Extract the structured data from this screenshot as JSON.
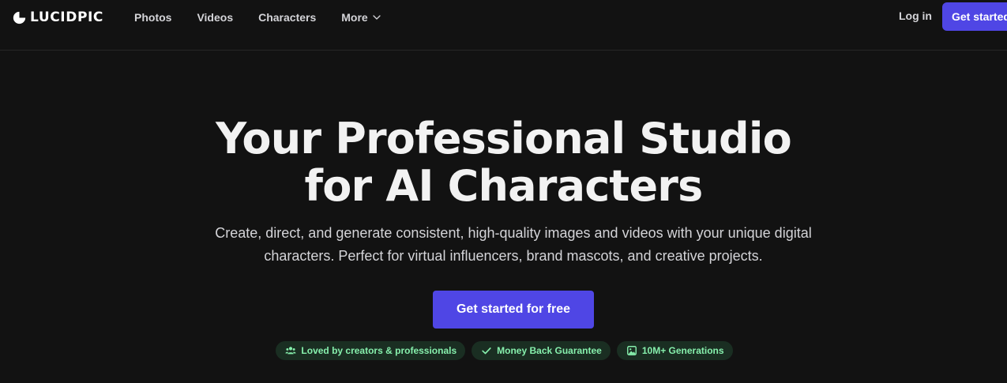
{
  "brand": {
    "name": "LUCIDPIC"
  },
  "nav": {
    "links": [
      "Photos",
      "Videos",
      "Characters",
      "More"
    ],
    "login_label": "Log in",
    "cta_label": "Get started"
  },
  "hero": {
    "title_line1": "Your Professional Studio",
    "title_line2": "for AI Characters",
    "subtitle": "Create, direct, and generate consistent, high-quality images and videos with your unique digital characters. Perfect for virtual influencers, brand mascots, and creative projects.",
    "cta_label": "Get started for free"
  },
  "badges": [
    {
      "icon": "users-icon",
      "label": "Loved by creators & professionals"
    },
    {
      "icon": "check-icon",
      "label": "Money Back Guarantee"
    },
    {
      "icon": "image-icon",
      "label": "10M+ Generations"
    }
  ],
  "colors": {
    "background": "#121212",
    "accent": "#4f46e5",
    "badge_bg": "#1a2e22",
    "badge_text": "#86efac",
    "nav_text": "#d4d4d8"
  }
}
